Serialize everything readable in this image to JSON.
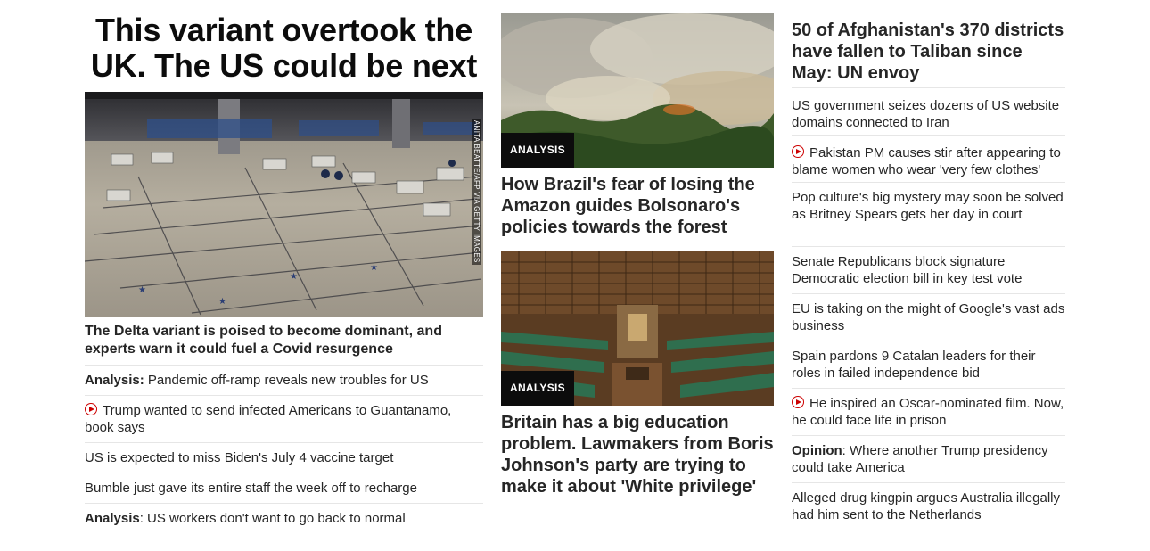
{
  "left": {
    "hero_title": "This variant overtook the UK. The US could be next",
    "image_credit": "ANITA BEATTE/AFP VIA GETTY IMAGES",
    "hero_caption": "The Delta variant is poised to become dominant, and experts warn it could fuel a Covid resurgence",
    "items": [
      {
        "prefix": "Analysis:",
        "text": " Pandemic off-ramp reveals new troubles for US"
      },
      {
        "icon": "play-icon",
        "text": "Trump wanted to send infected Americans to Guantanamo, book says"
      },
      {
        "text": "US is expected to miss Biden's July 4 vaccine target"
      },
      {
        "text": "Bumble just gave its entire staff the week off to recharge"
      },
      {
        "prefix": "Analysis",
        "text": ": US workers don't want to go back to normal"
      }
    ]
  },
  "middle": {
    "story1": {
      "badge": "ANALYSIS",
      "headline": "How Brazil's fear of losing the Amazon guides Bolsonaro's policies towards the forest"
    },
    "story2": {
      "badge": "ANALYSIS",
      "headline": "Britain has a big education problem. Lawmakers from Boris Johnson's party are trying to make it about 'White privilege'"
    }
  },
  "right": {
    "headline": "50 of Afghanistan's 370 districts have fallen to Taliban since May: UN envoy",
    "items": [
      {
        "text": "US government seizes dozens of US website domains connected to Iran"
      },
      {
        "icon": "play-icon",
        "text": "Pakistan PM causes stir after appearing to blame women who wear 'very few clothes'"
      },
      {
        "text": "Pop culture's big mystery may soon be solved as Britney Spears gets her day in court"
      },
      {
        "text": "Senate Republicans block signature Democratic election bill in key test vote"
      },
      {
        "text": "EU is taking on the might of Google's vast ads business"
      },
      {
        "text": "Spain pardons 9 Catalan leaders for their roles in failed independence bid"
      },
      {
        "icon": "play-icon",
        "text": "He inspired an Oscar-nominated film. Now, he could face life in prison"
      },
      {
        "prefix": "Opinion",
        "text": ": Where another Trump presidency could take America"
      },
      {
        "text": "Alleged drug kingpin argues Australia illegally had him sent to the Netherlands"
      }
    ]
  },
  "colors": {
    "play_icon": "#cc0000",
    "badge_bg": "#0c0c0c",
    "divider": "#e6e6e6",
    "text": "#262626"
  }
}
